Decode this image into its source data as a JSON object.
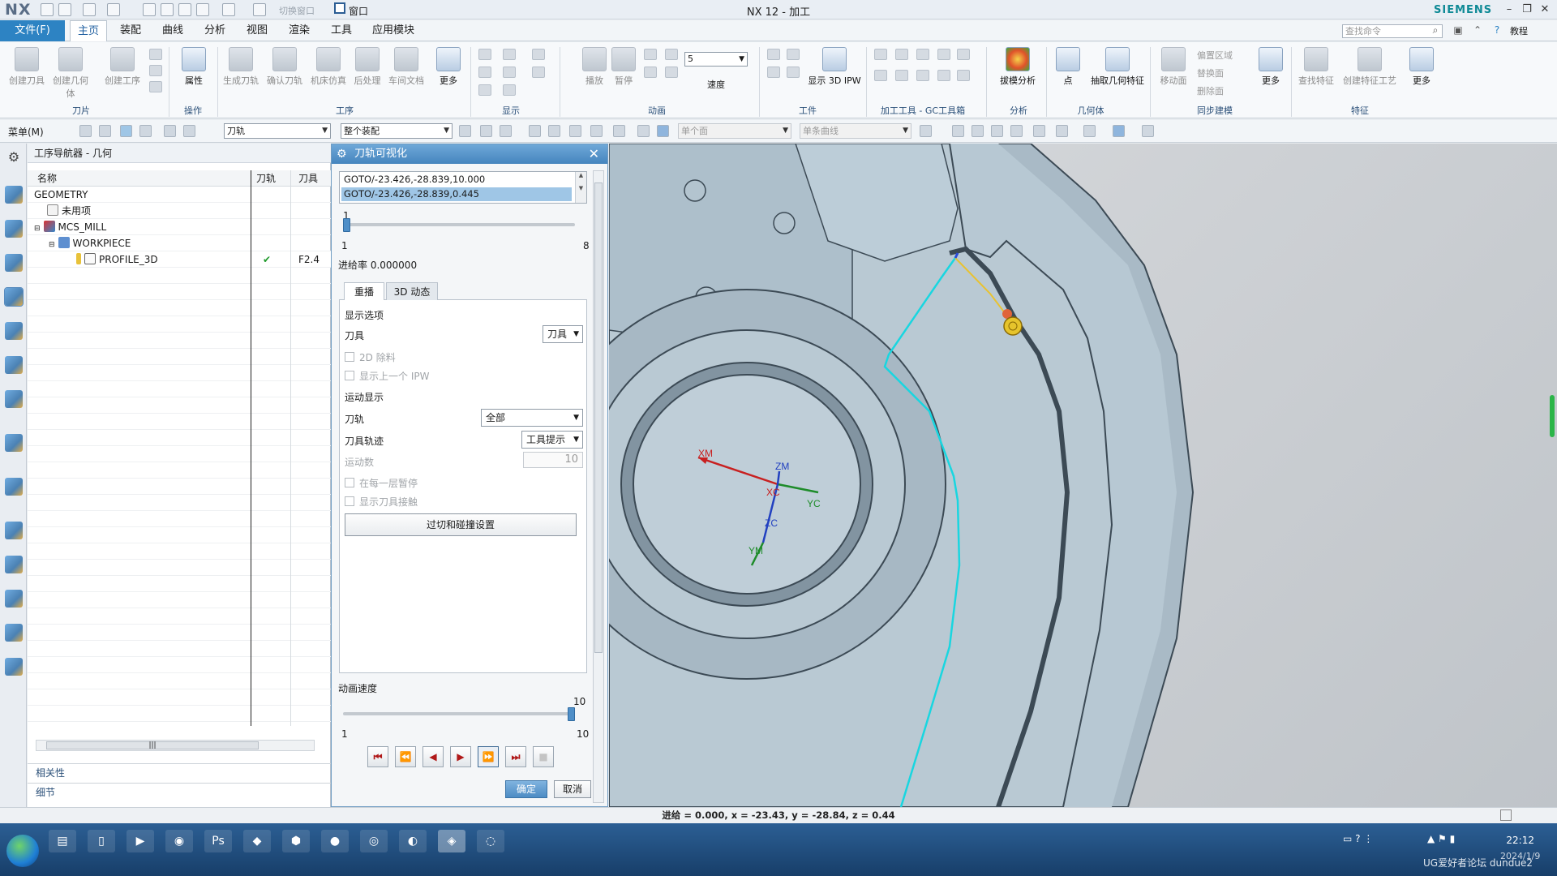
{
  "app": {
    "logo": "NX",
    "title": "NX 12 - 加工",
    "brand": "SIEMENS",
    "accent": "#2d83c3"
  },
  "quickaccess": {
    "switch_window": "切换窗口",
    "window": "窗口"
  },
  "menubar": {
    "file": "文件(F)",
    "tabs": [
      "主页",
      "装配",
      "曲线",
      "分析",
      "视图",
      "渲染",
      "工具",
      "应用模块"
    ],
    "active_tab": "主页",
    "search_placeholder": "查找命令",
    "tutorial": "教程"
  },
  "ribbon": {
    "buttons": {
      "create_tool": "创建刀具",
      "create_geometry": "创建几何体",
      "create_operation": "创建工序",
      "properties": "属性",
      "more": "更多",
      "generate_path": "生成刀轨",
      "verify_path": "确认刀轨",
      "machine_sim": "机床仿真",
      "postprocess": "后处理",
      "shop_doc": "车间文档",
      "play": "播放",
      "pause": "暂停",
      "speed": "速度",
      "speed_value": "5",
      "show_3d_ipw": "显示 3D IPW",
      "draft_analysis": "拔模分析",
      "point": "点",
      "extract_geometry": "抽取几何特征",
      "move_face": "移动面",
      "replace_face": "替换面",
      "delete_face": "删除面",
      "offset_region": "偏置区域",
      "more2": "更多",
      "find_feature": "查找特征",
      "create_feature_process": "创建特征工艺",
      "more3": "更多"
    },
    "groups": {
      "tool": "刀片",
      "operation": "操作",
      "process": "工序",
      "display": "显示",
      "animation": "动画",
      "workpiece": "工件",
      "gc_toolkit": "加工工具 - GC工具箱",
      "analysis": "分析",
      "geometry": "几何体",
      "sync_modeling": "同步建模",
      "feature": "特征"
    }
  },
  "selectionbar": {
    "menu": "菜单(M)",
    "filter": "刀轨",
    "scope": "整个装配",
    "face_rule": "单个面",
    "curve_rule": "单条曲线"
  },
  "navigator": {
    "title": "工序导航器 - 几何",
    "columns": [
      "名称",
      "刀轨",
      "刀具"
    ],
    "rows": [
      {
        "name": "GEOMETRY",
        "path": "",
        "tool": ""
      },
      {
        "name": "未用项",
        "path": "",
        "tool": ""
      },
      {
        "name": "MCS_MILL",
        "path": "",
        "tool": ""
      },
      {
        "name": "WORKPIECE",
        "path": "",
        "tool": ""
      },
      {
        "name": "PROFILE_3D",
        "path": "✔",
        "tool": "F2.4"
      }
    ],
    "sections": [
      "相关性",
      "细节"
    ]
  },
  "dialog": {
    "title": "刀轨可视化",
    "goto_lines": [
      "GOTO/-23.426,-28.839,10.000",
      "GOTO/-23.426,-28.839,0.445"
    ],
    "step_value": "1",
    "step_min": "1",
    "step_max": "8",
    "step_fraction": 0.0,
    "feed_rate_label": "进给率 0.000000",
    "tabs": [
      "重播",
      "3D 动态"
    ],
    "display_options": "显示选项",
    "tool_label": "刀具",
    "tool_value": "刀具",
    "cb_2d_material": "2D 除料",
    "cb_prev_ipw": "显示上一个 IPW",
    "motion_display": "运动显示",
    "path_label": "刀轨",
    "path_value": "全部",
    "trace_label": "刀具轨迹",
    "trace_value": "工具提示",
    "motion_count_label": "运动数",
    "motion_count_value": "10",
    "cb_pause_each_layer": "在每一层暂停",
    "cb_show_contact": "显示刀具接触",
    "gouge_button": "过切和碰撞设置",
    "anim_speed_label": "动画速度",
    "anim_speed_value": "10",
    "anim_min": "1",
    "anim_max": "10",
    "anim_fraction": 1.0,
    "ok": "确定",
    "cancel": "取消"
  },
  "viewport": {
    "axes": {
      "xm": "XM",
      "zm": "ZM",
      "xc": "XC",
      "yc": "YC",
      "zc": "ZC",
      "ym": "YM"
    },
    "path_color": "#19d6e0"
  },
  "statusbar": {
    "text": "进给 = 0.000, x = -23.43, y = -28.84, z = 0.44"
  },
  "taskbar": {
    "time": "22:12",
    "date": "2024/1/9",
    "watermark": "UG爱好者论坛 dundue2"
  }
}
